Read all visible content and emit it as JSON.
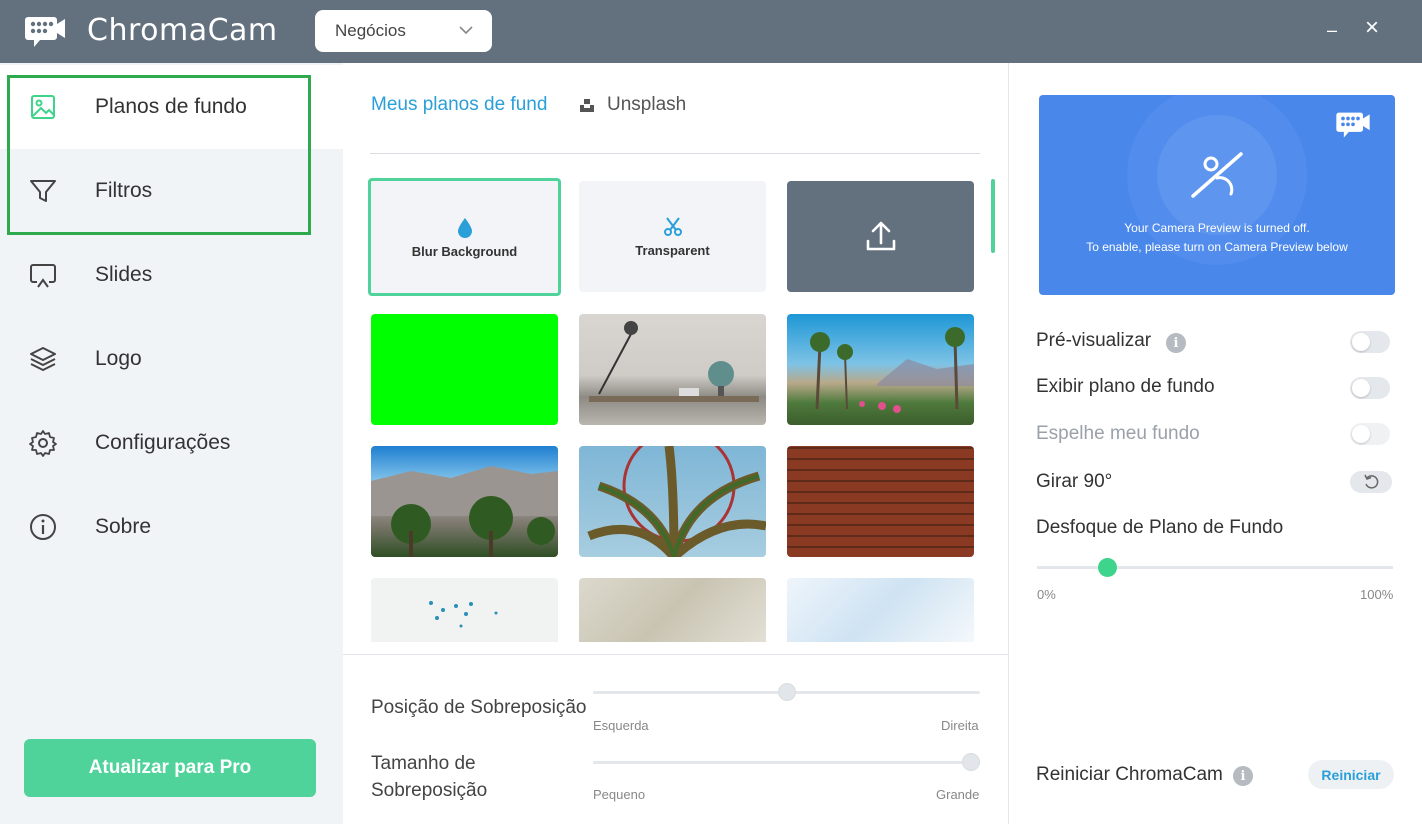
{
  "app": {
    "title": "ChromaCam",
    "profile": "Negócios",
    "minimize": "–",
    "close": "×"
  },
  "sidebar": {
    "items": [
      {
        "label": "Planos de fundo",
        "icon": "image-icon"
      },
      {
        "label": "Filtros",
        "icon": "filter-icon"
      },
      {
        "label": "Slides",
        "icon": "slides-icon"
      },
      {
        "label": "Logo",
        "icon": "layers-icon"
      },
      {
        "label": "Configurações",
        "icon": "gear-icon"
      },
      {
        "label": "Sobre",
        "icon": "info-icon"
      }
    ],
    "upgrade": "Atualizar para Pro"
  },
  "main": {
    "tabs": {
      "mine": "Meus planos de fund",
      "unsplash": "Unsplash"
    },
    "tiles": {
      "blur": "Blur Background",
      "transparent": "Transparent"
    },
    "overlay": {
      "position_label": "Posição de Sobreposição",
      "position_min": "Esquerda",
      "position_max": "Direita",
      "position_value": 0.5,
      "size_label_1": "Tamanho de",
      "size_label_2": "Sobreposição",
      "size_min": "Pequeno",
      "size_max": "Grande",
      "size_value": 1.0
    }
  },
  "right": {
    "preview_line1": "Your Camera Preview is turned off.",
    "preview_line2": "To enable, please turn on Camera Preview below",
    "preview": "Pré-visualizar",
    "show_bg": "Exibir plano de fundo",
    "mirror": "Espelhe meu fundo",
    "rotate": "Girar 90°",
    "blur_label": "Desfoque de Plano de Fundo",
    "blur_min": "0%",
    "blur_max": "100%",
    "blur_value": 0.18,
    "restart_label": "Reiniciar ChromaCam",
    "restart_button": "Reiniciar",
    "info_glyph": "i"
  },
  "colors": {
    "accent": "#4fd39b",
    "link": "#2a9fd8",
    "titlebar": "#63717f",
    "preview": "#4a87ea"
  }
}
